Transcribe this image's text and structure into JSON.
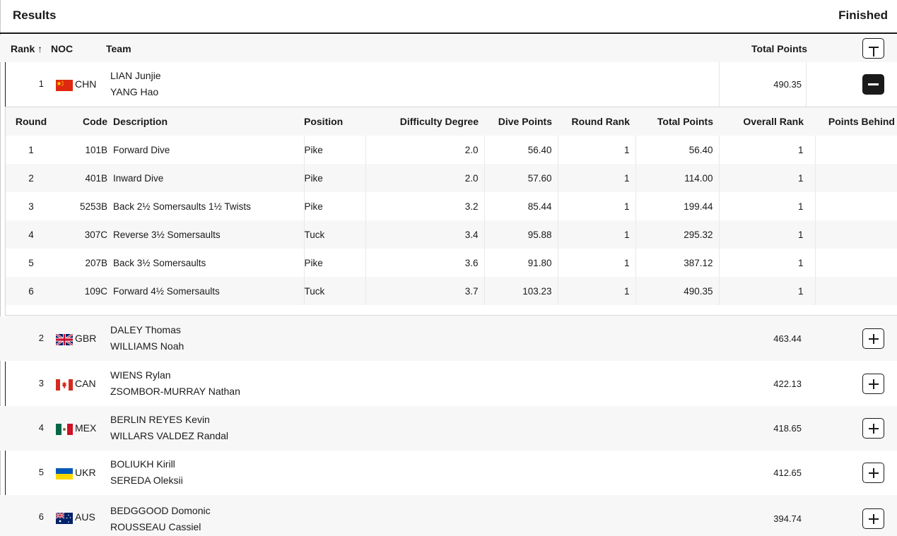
{
  "header": {
    "title": "Results",
    "status": "Finished"
  },
  "columns": {
    "rank": "Rank ↑",
    "noc": "NOC",
    "team": "Team",
    "total_points": "Total Points"
  },
  "detail_columns": {
    "round": "Round",
    "code": "Code",
    "description": "Description",
    "position": "Position",
    "difficulty": "Difficulty Degree",
    "dive_points": "Dive Points",
    "round_rank": "Round Rank",
    "total_points": "Total Points",
    "overall_rank": "Overall Rank",
    "points_behind": "Points Behind"
  },
  "teams": [
    {
      "rank": "1",
      "noc": "CHN",
      "flag": "china-flag-icon",
      "athletes": [
        "LIAN Junjie",
        "YANG Hao"
      ],
      "total": "490.35",
      "expanded": true
    },
    {
      "rank": "2",
      "noc": "GBR",
      "flag": "uk-flag-icon",
      "athletes": [
        "DALEY Thomas",
        "WILLIAMS Noah"
      ],
      "total": "463.44",
      "expanded": false
    },
    {
      "rank": "3",
      "noc": "CAN",
      "flag": "canada-flag-icon",
      "athletes": [
        "WIENS Rylan",
        "ZSOMBOR-MURRAY Nathan"
      ],
      "total": "422.13",
      "expanded": false
    },
    {
      "rank": "4",
      "noc": "MEX",
      "flag": "mexico-flag-icon",
      "athletes": [
        "BERLIN REYES Kevin",
        "WILLARS VALDEZ Randal"
      ],
      "total": "418.65",
      "expanded": false
    },
    {
      "rank": "5",
      "noc": "UKR",
      "flag": "ukraine-flag-icon",
      "athletes": [
        "BOLIUKH Kirill",
        "SEREDA Oleksii"
      ],
      "total": "412.65",
      "expanded": false
    },
    {
      "rank": "6",
      "noc": "AUS",
      "flag": "australia-flag-icon",
      "athletes": [
        "BEDGGOOD Domonic",
        "ROUSSEAU Cassiel"
      ],
      "total": "394.74",
      "expanded": false
    }
  ],
  "dives": [
    {
      "round": "1",
      "code": "101B",
      "description": "Forward Dive",
      "position": "Pike",
      "difficulty": "2.0",
      "dive_points": "56.40",
      "round_rank": "1",
      "total_points": "56.40",
      "overall_rank": "1",
      "points_behind": ""
    },
    {
      "round": "2",
      "code": "401B",
      "description": "Inward Dive",
      "position": "Pike",
      "difficulty": "2.0",
      "dive_points": "57.60",
      "round_rank": "1",
      "total_points": "114.00",
      "overall_rank": "1",
      "points_behind": ""
    },
    {
      "round": "3",
      "code": "5253B",
      "description": "Back 2½ Somersaults 1½ Twists",
      "position": "Pike",
      "difficulty": "3.2",
      "dive_points": "85.44",
      "round_rank": "1",
      "total_points": "199.44",
      "overall_rank": "1",
      "points_behind": ""
    },
    {
      "round": "4",
      "code": "307C",
      "description": "Reverse 3½ Somersaults",
      "position": "Tuck",
      "difficulty": "3.4",
      "dive_points": "95.88",
      "round_rank": "1",
      "total_points": "295.32",
      "overall_rank": "1",
      "points_behind": ""
    },
    {
      "round": "5",
      "code": "207B",
      "description": "Back 3½ Somersaults",
      "position": "Pike",
      "difficulty": "3.6",
      "dive_points": "91.80",
      "round_rank": "1",
      "total_points": "387.12",
      "overall_rank": "1",
      "points_behind": ""
    },
    {
      "round": "6",
      "code": "109C",
      "description": "Forward 4½ Somersaults",
      "position": "Tuck",
      "difficulty": "3.7",
      "dive_points": "103.23",
      "round_rank": "1",
      "total_points": "490.35",
      "overall_rank": "1",
      "points_behind": ""
    }
  ],
  "colors": {
    "accent": "#1a1a1a",
    "row_shade": "#f7f7f7",
    "china_red": "#de2910",
    "china_yellow": "#ffde00"
  }
}
